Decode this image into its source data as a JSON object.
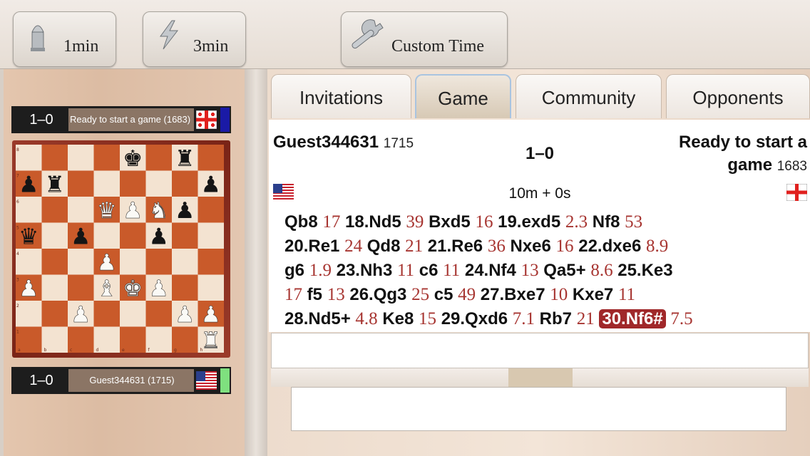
{
  "toolbar": {
    "one_min_label": "1min",
    "three_min_label": "3min",
    "custom_label": "Custom Time"
  },
  "left_panel": {
    "top_player": {
      "score": "1–0",
      "name": "Ready to start a game (1683)",
      "flag": "Georgia",
      "indicator_color": "#1a1aa6"
    },
    "bottom_player": {
      "score": "1–0",
      "name": "Guest344631 (1715)",
      "flag": "USA",
      "indicator_color": "#7fe07f"
    },
    "board": {
      "files": [
        "a",
        "b",
        "c",
        "d",
        "e",
        "f",
        "g",
        "h"
      ],
      "ranks": [
        "8",
        "7",
        "6",
        "5",
        "4",
        "3",
        "2",
        "1"
      ],
      "rows": [
        "....k.r.",
        "pr.....p",
        "...QPNp.",
        "q.p..p..",
        "...P....",
        "P..BKP..",
        "..P...PP",
        ".......R"
      ]
    }
  },
  "tabs": [
    "Invitations",
    "Game",
    "Community",
    "Opponents"
  ],
  "active_tab": "Game",
  "game_info": {
    "white_name": "Guest344631",
    "white_rating": "1715",
    "black_name_line1": "Ready to start a",
    "black_name_line2": "game",
    "black_rating": "1683",
    "result": "1–0",
    "time_control": "10m + 0s",
    "white_flag": "USA",
    "black_flag": "Georgia"
  },
  "moves": [
    [
      {
        "t": "Qb8",
        "k": "m"
      },
      {
        "t": "17",
        "k": "t"
      },
      {
        "t": "18.Nd5",
        "k": "m"
      },
      {
        "t": "39",
        "k": "t"
      },
      {
        "t": "Bxd5",
        "k": "m"
      },
      {
        "t": "16",
        "k": "t"
      },
      {
        "t": "19.exd5",
        "k": "m"
      },
      {
        "t": "2.3",
        "k": "t"
      },
      {
        "t": "Nf8",
        "k": "m"
      },
      {
        "t": "53",
        "k": "t"
      }
    ],
    [
      {
        "t": "20.Re1",
        "k": "m"
      },
      {
        "t": "24",
        "k": "t"
      },
      {
        "t": "Qd8",
        "k": "m"
      },
      {
        "t": "21",
        "k": "t"
      },
      {
        "t": "21.Re6",
        "k": "m"
      },
      {
        "t": "36",
        "k": "t"
      },
      {
        "t": "Nxe6",
        "k": "m"
      },
      {
        "t": "16",
        "k": "t"
      },
      {
        "t": "22.dxe6",
        "k": "m"
      },
      {
        "t": "8.9",
        "k": "t"
      }
    ],
    [
      {
        "t": "g6",
        "k": "m"
      },
      {
        "t": "1.9",
        "k": "t"
      },
      {
        "t": "23.Nh3",
        "k": "m"
      },
      {
        "t": "11",
        "k": "t"
      },
      {
        "t": "c6",
        "k": "m"
      },
      {
        "t": "11",
        "k": "t"
      },
      {
        "t": "24.Nf4",
        "k": "m"
      },
      {
        "t": "13",
        "k": "t"
      },
      {
        "t": "Qa5+",
        "k": "m"
      },
      {
        "t": "8.6",
        "k": "t"
      },
      {
        "t": "25.Ke3",
        "k": "m"
      }
    ],
    [
      {
        "t": "17",
        "k": "t"
      },
      {
        "t": "f5",
        "k": "m"
      },
      {
        "t": "13",
        "k": "t"
      },
      {
        "t": "26.Qg3",
        "k": "m"
      },
      {
        "t": "25",
        "k": "t"
      },
      {
        "t": "c5",
        "k": "m"
      },
      {
        "t": "49",
        "k": "t"
      },
      {
        "t": "27.Bxe7",
        "k": "m"
      },
      {
        "t": "10",
        "k": "t"
      },
      {
        "t": "Kxe7",
        "k": "m"
      },
      {
        "t": "11",
        "k": "t"
      }
    ],
    [
      {
        "t": "28.Nd5+",
        "k": "m"
      },
      {
        "t": "4.8",
        "k": "t"
      },
      {
        "t": "Ke8",
        "k": "m"
      },
      {
        "t": "15",
        "k": "t"
      },
      {
        "t": "29.Qxd6",
        "k": "m"
      },
      {
        "t": "7.1",
        "k": "t"
      },
      {
        "t": "Rb7",
        "k": "m"
      },
      {
        "t": "21",
        "k": "t"
      },
      {
        "t": "30.Nf6#",
        "k": "h"
      },
      {
        "t": "7.5",
        "k": "t"
      }
    ]
  ],
  "colors": {
    "light_square": "#f3e3d1",
    "dark_square": "#c95a2a",
    "time_text": "#a73531",
    "highlight_move": "#a0282a"
  }
}
